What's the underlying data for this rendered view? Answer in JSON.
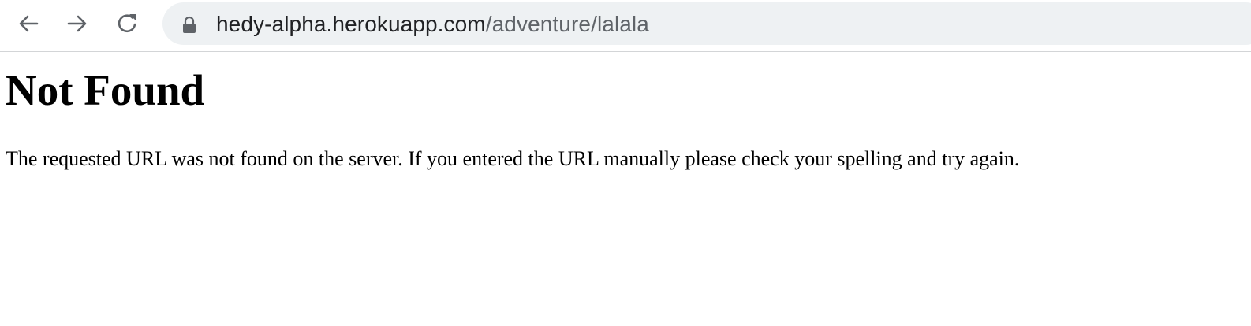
{
  "browser": {
    "url_host": "hedy-alpha.herokuapp.com",
    "url_path": "/adventure/lalala",
    "icons": {
      "back": "arrow-left-icon",
      "forward": "arrow-right-icon",
      "reload": "reload-icon",
      "lock": "lock-icon"
    },
    "colors": {
      "omnibox_bg": "#eef1f3",
      "icon": "#5f6368",
      "host_text": "#202124",
      "path_text": "#5f6368"
    }
  },
  "page": {
    "title": "Not Found",
    "message": "The requested URL was not found on the server. If you entered the URL manually please check your spelling and try again."
  }
}
